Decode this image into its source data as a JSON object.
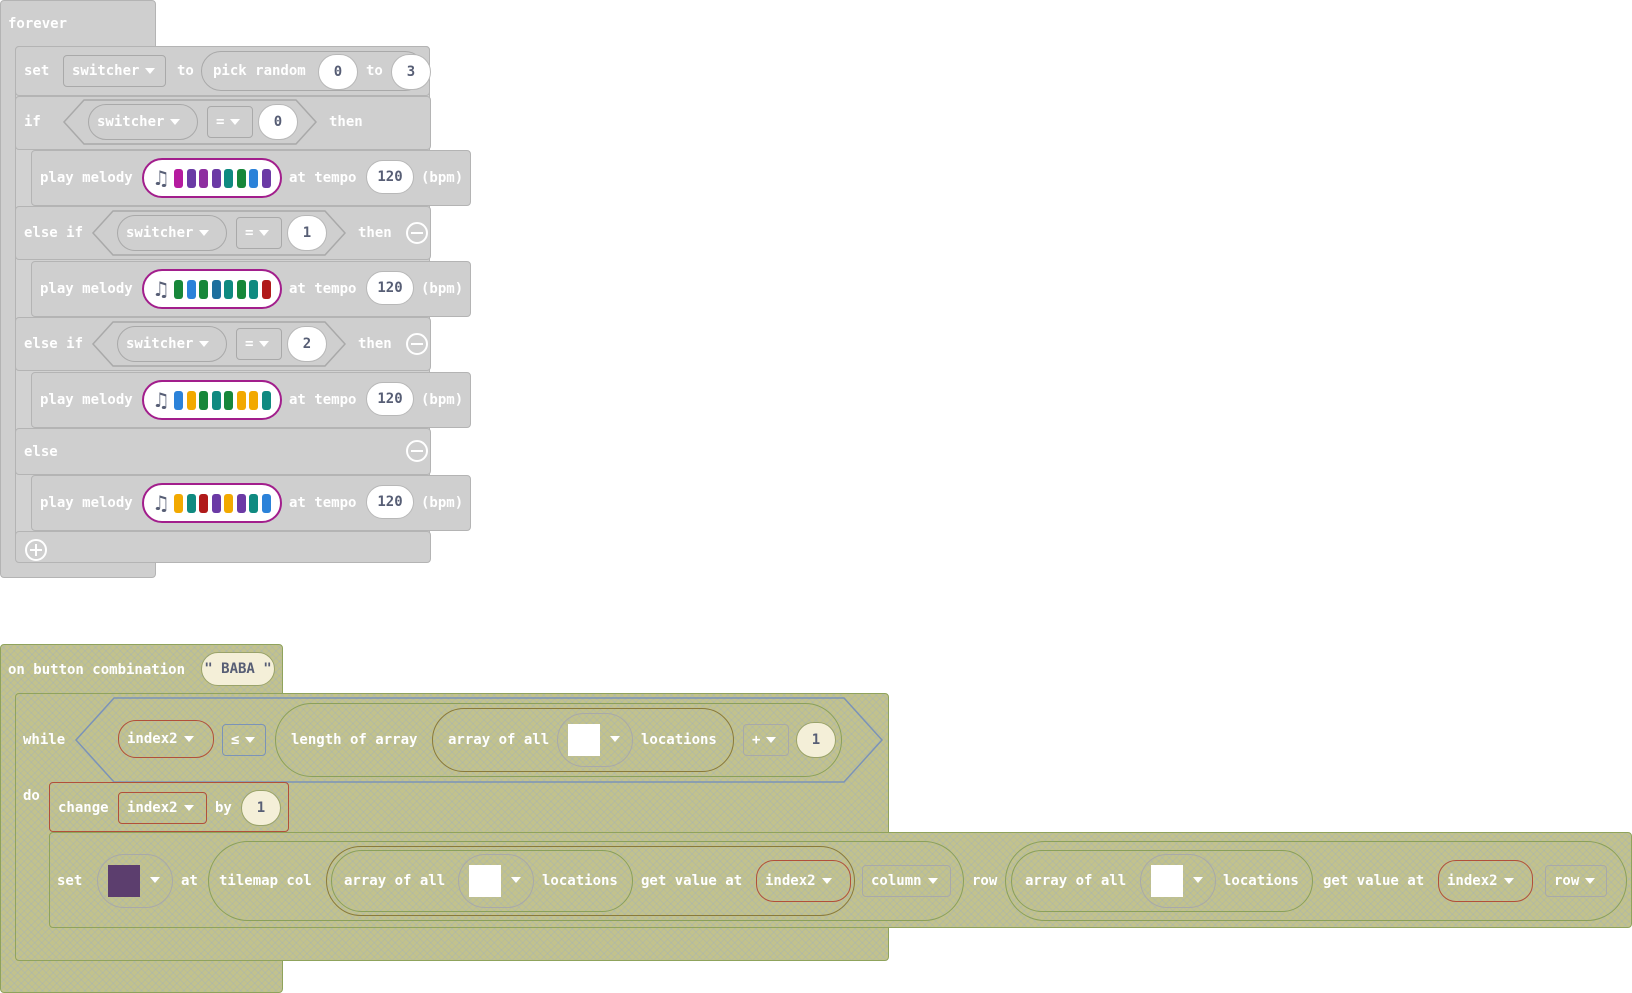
{
  "forever": {
    "hat": "forever",
    "set": {
      "kw": "set",
      "var": "switcher",
      "to": "to",
      "pick": "pick random",
      "from": "0",
      "to2": "to",
      "max": "3"
    },
    "if": "if",
    "then": "then",
    "else_if": "else if",
    "else": "else",
    "op": "=",
    "var": "switcher",
    "cond_values": [
      "0",
      "1",
      "2"
    ],
    "play": {
      "kw": "play melody",
      "at": "at tempo",
      "tempo": "120",
      "bpm": "(bpm)"
    },
    "melodies": [
      [
        "#b51b9f",
        "#6b3aa5",
        "#8e2ea0",
        "#6b3aa5",
        "#0f8a80",
        "#17873a",
        "#2b82d9",
        "#6b3aa5"
      ],
      [
        "#17873a",
        "#2b82d9",
        "#17873a",
        "#1d6f9e",
        "#0f8a80",
        "#17873a",
        "#0f8a80",
        "#b01a1a"
      ],
      [
        "#2b82d9",
        "#f2a900",
        "#17873a",
        "#0f8a80",
        "#17873a",
        "#f2a900",
        "#f2a900",
        "#0f8a80"
      ],
      [
        "#f2a900",
        "#0f8a80",
        "#b01a1a",
        "#6b3aa5",
        "#f2a900",
        "#6b3aa5",
        "#0f8a80",
        "#2b82d9"
      ]
    ]
  },
  "combo": {
    "hat": "on button combination",
    "combo_value": "\" BABA \"",
    "while": "while",
    "do": "do",
    "index_var": "index2",
    "le": "≤",
    "length_of_array": "length of array",
    "array_of_all": "array of all",
    "locations": "locations",
    "plus": "+",
    "one": "1",
    "change": "change",
    "by": "by",
    "set": "set",
    "at": "at",
    "tilemap_col": "tilemap col",
    "get_value_at": "get value at",
    "column": "column",
    "row_kw": "row",
    "row_dd": "row",
    "tile_color": "#5c3e6e"
  }
}
